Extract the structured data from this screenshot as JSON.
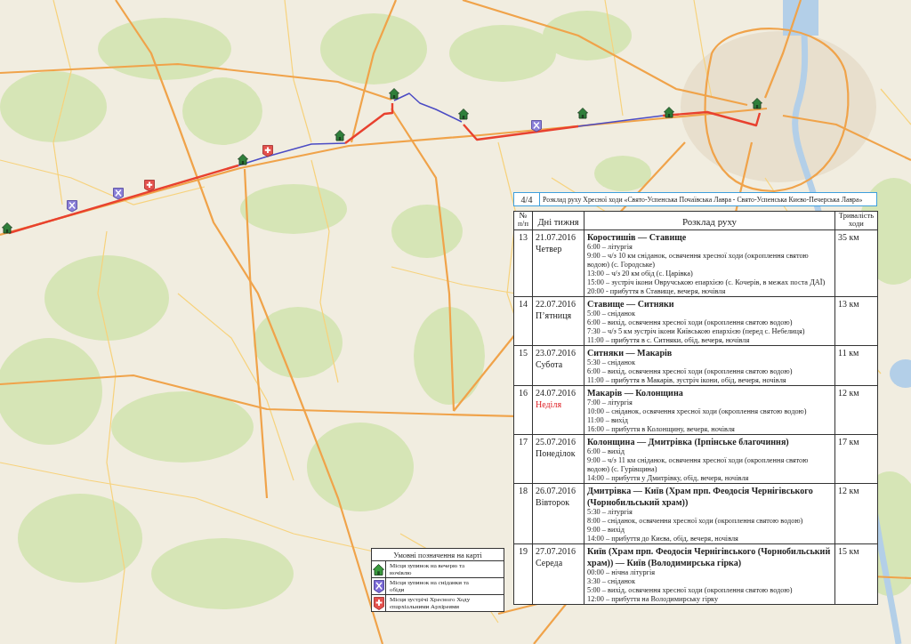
{
  "header": {
    "page": "4/4",
    "title": "Розклад руху Хресної ходи «Свято-Успенська Почаївська Лавра - Свято-Успенська Києво-Печерська Лавра»"
  },
  "schedule": {
    "columns": [
      "№ п/п",
      "Дні тижня",
      "Розклад руху",
      "Тривалість ходи"
    ],
    "rows": [
      {
        "number": "13",
        "date": "21.07.2016",
        "weekday": "Четвер",
        "holiday": false,
        "route": "Коростишів — Ставище",
        "events": [
          "6:00 – літургія",
          "9:00 – ч/з 10 км сніданок, освячення хресної ходи (окроплення святою водою) (с. Городське)",
          "13:00 – ч/з 20 км обід (с. Царівка)",
          "15:00 – зустріч ікони Овручською епархією (с. Кочерів, в межах поста ДАЇ)",
          "20:00 - прибуття в Ставище, вечеря, ночівля"
        ],
        "distance": "35 км"
      },
      {
        "number": "14",
        "date": "22.07.2016",
        "weekday": "П’ятниця",
        "holiday": false,
        "route": "Ставище — Ситняки",
        "events": [
          "5:00 – сніданок",
          "6:00 – вихід, освячення хресної ходи (окроплення святою водою)",
          "7:30 – ч/з 5 км зустріч ікони Київською епархією (перед с. Небелиця)",
          "11:00 – прибуття в с. Ситняки, обід, вечеря, ночівля"
        ],
        "distance": "13 км"
      },
      {
        "number": "15",
        "date": "23.07.2016",
        "weekday": "Субота",
        "holiday": false,
        "route": "Ситняки — Макарів",
        "events": [
          "5:30 – сніданок",
          "6:00 – вихід, освячення хресної ходи (окроплення святою водою)",
          "11:00 – прибуття в Макарів, зустріч ікони, обід, вечеря, ночівля"
        ],
        "distance": "11 км"
      },
      {
        "number": "16",
        "date": "24.07.2016",
        "weekday": "Неділя",
        "holiday": true,
        "route": "Макарів — Колонщина",
        "events": [
          "7:00 – літургія",
          "10:00 – сніданок, освячення хресної ходи (окроплення святою водою)",
          "11:00 – вихід",
          "16:00 – прибуття в Колонщину, вечеря, ночівля"
        ],
        "distance": "12 км"
      },
      {
        "number": "17",
        "date": "25.07.2016",
        "weekday": "Понеділок",
        "holiday": false,
        "route": "Колонщина — Дмитрівка (Ірпінське благочиння)",
        "events": [
          "6:00 – вихід",
          "9:00 – ч/з 11 км сніданок, освячення хресної ходи (окроплення святою водою) (с. Гурівщина)",
          "14:00 – прибуття у Дмитрівку, обід, вечеря, ночівля"
        ],
        "distance": "17 км"
      },
      {
        "number": "18",
        "date": "26.07.2016",
        "weekday": "Вівторок",
        "holiday": false,
        "route": "Дмитрівка — Київ (Храм прп. Феодосія Чернігівського (Чорнобильський храм))",
        "events": [
          "5:30 – літургія",
          "8:00 – сніданок, освячення хресної ходи (окроплення святою водою)",
          "9:00 – вихід",
          "14:00 – прибуття до Києва, обід, вечеря, ночівля"
        ],
        "distance": "12 км"
      },
      {
        "number": "19",
        "date": "27.07.2016",
        "weekday": "Середа",
        "holiday": false,
        "route": "Київ (Храм прп. Феодосія Чернігівського (Чорнобильський храм)) — Київ (Володимирська гірка)",
        "events": [
          "00:00 – нічна літургія",
          "3:30 – сніданок",
          "5:00 – вихід, освячення хресної ходи (окроплення святою водою)",
          "12:00 – прибуття на Володимирську гірку"
        ],
        "distance": "15 км"
      }
    ]
  },
  "legend": {
    "title": "Умовні позначення на карті",
    "items": [
      {
        "kind": "night",
        "label": "Місця зупинок на вечерю та ночівлю"
      },
      {
        "kind": "meal",
        "label": "Місця зупинок на сніданки та обіди"
      },
      {
        "kind": "meeting",
        "label": "Місця зустрічі Хресного Ходу єпархіальними Архіреями"
      }
    ]
  }
}
